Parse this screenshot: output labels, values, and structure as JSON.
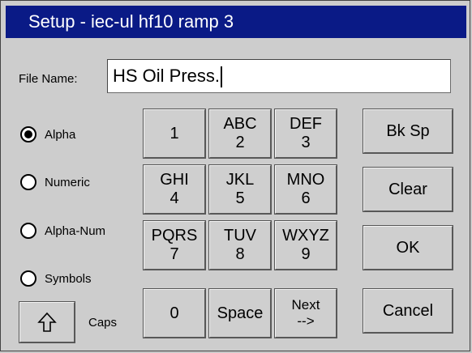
{
  "window": {
    "title": "Setup - iec-ul hf10 ramp 3"
  },
  "file_name": {
    "label": "File Name:",
    "value": "HS Oil Press."
  },
  "modes": [
    {
      "label": "Alpha",
      "selected": true
    },
    {
      "label": "Numeric",
      "selected": false
    },
    {
      "label": "Alpha-Num",
      "selected": false
    },
    {
      "label": "Symbols",
      "selected": false
    }
  ],
  "keys": [
    {
      "top": "",
      "bottom": "1"
    },
    {
      "top": "ABC",
      "bottom": "2"
    },
    {
      "top": "DEF",
      "bottom": "3"
    },
    {
      "top": "GHI",
      "bottom": "4"
    },
    {
      "top": "JKL",
      "bottom": "5"
    },
    {
      "top": "MNO",
      "bottom": "6"
    },
    {
      "top": "PQRS",
      "bottom": "7"
    },
    {
      "top": "TUV",
      "bottom": "8"
    },
    {
      "top": "WXYZ",
      "bottom": "9"
    },
    {
      "top": "",
      "bottom": "0"
    },
    {
      "top": "",
      "bottom": "Space"
    },
    {
      "top": "Next",
      "bottom": "-->"
    }
  ],
  "actions": {
    "backspace": "Bk Sp",
    "clear": "Clear",
    "ok": "OK",
    "cancel": "Cancel"
  },
  "caps": {
    "label": "Caps",
    "icon": "up-arrow-icon"
  }
}
